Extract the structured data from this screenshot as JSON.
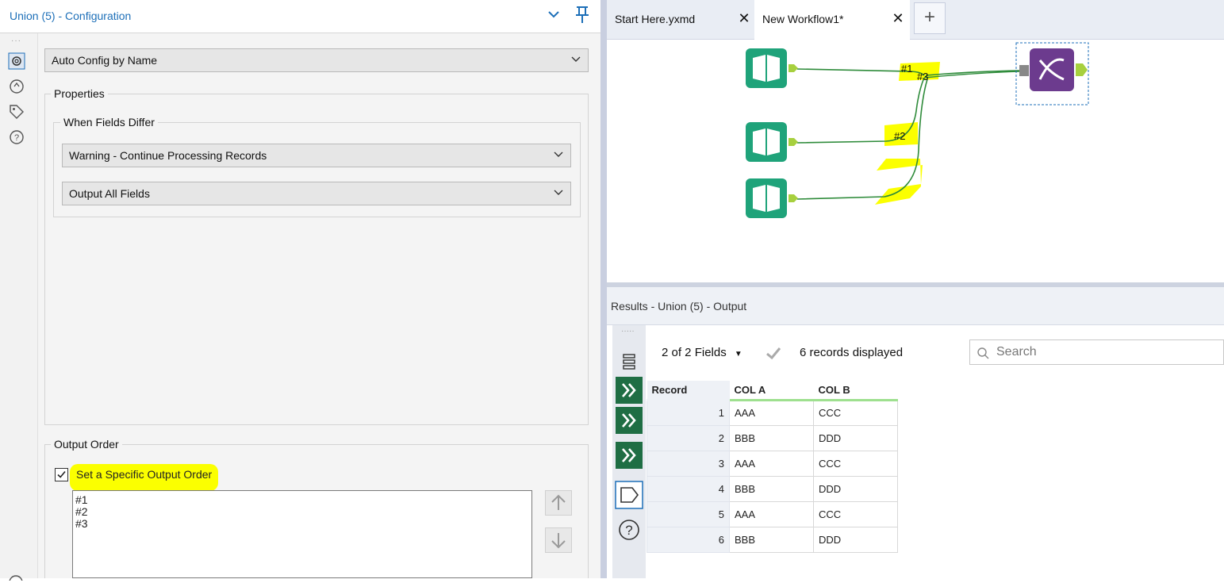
{
  "config": {
    "title": "Union (5) - Configuration",
    "mode_dropdown": "Auto Config by Name",
    "properties_label": "Properties",
    "when_fields_differ_label": "When Fields Differ",
    "fields_differ_dropdown": "Warning - Continue Processing Records",
    "output_fields_dropdown": "Output All Fields",
    "output_order_label": "Output Order",
    "set_order_checkbox_label": "Set a Specific Output Order",
    "set_order_checked": true,
    "order_items": [
      "#1",
      "#2",
      "#3"
    ]
  },
  "tabs": [
    {
      "label": "Start Here.yxmd",
      "active": false
    },
    {
      "label": "New Workflow1*",
      "active": true
    }
  ],
  "canvas": {
    "connection_labels": [
      "#1",
      "#3",
      "#2"
    ]
  },
  "results": {
    "title": "Results - Union (5) - Output",
    "fields_selector": "2 of 2 Fields",
    "records_displayed": "6 records displayed",
    "search_placeholder": "Search",
    "columns": [
      "Record",
      "COL A",
      "COL B"
    ],
    "rows": [
      [
        "1",
        "AAA",
        "CCC"
      ],
      [
        "2",
        "BBB",
        "DDD"
      ],
      [
        "3",
        "AAA",
        "CCC"
      ],
      [
        "4",
        "BBB",
        "DDD"
      ],
      [
        "5",
        "AAA",
        "CCC"
      ],
      [
        "6",
        "BBB",
        "DDD"
      ]
    ]
  },
  "colors": {
    "accent_blue": "#1d6fb8",
    "input_tool_green": "#1fa37a",
    "union_tool_purple": "#6c3b8e",
    "highlight_yellow": "#fbff00",
    "connector_green": "#2e8b3a",
    "results_nav_green": "#1f6e44"
  }
}
